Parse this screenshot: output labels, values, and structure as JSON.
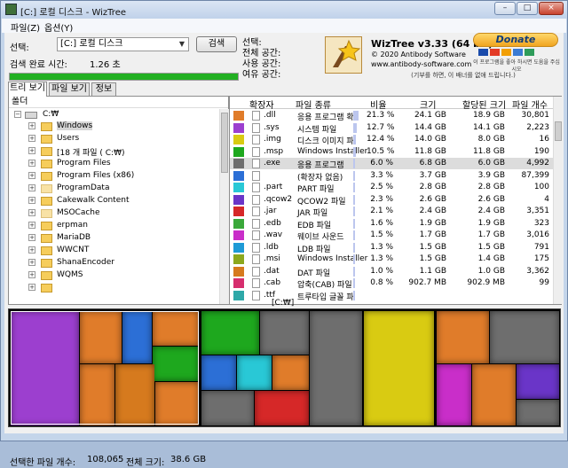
{
  "window": {
    "title": "[C:] 로컬 디스크 - WizTree",
    "controls": {
      "minimize": "–",
      "maximize": "□",
      "close": "×"
    }
  },
  "menu": [
    "파일(Z)",
    "옵션(Y)"
  ],
  "scan": {
    "select_label": "선택:",
    "drive_value": "[C:] 로컬 디스크",
    "search_button": "검색",
    "time_label": "검색 완료 시간:",
    "time_value": "1.26 초",
    "progress": 1.0,
    "progress_color": "#22b022"
  },
  "info": {
    "select_label": "선택:",
    "total_label": "전체 공간:",
    "used_label": "사용 공간:",
    "free_label": "여유 공간:"
  },
  "about": {
    "title": "WizTree v3.33 (64 bit)",
    "copyright": "© 2020 Antibody Software",
    "website": "www.antibody-software.com",
    "sponsor": "(기부를 하면, 이 배너를 없애 드립니다.)"
  },
  "donate": {
    "label": "Donate",
    "note": "이 프로그램을 좋아 하시면 도움을 주십시오",
    "card_colors": [
      "#1a4bab",
      "#e33b26",
      "#f29f05",
      "#3b7bd3",
      "#2e9c5a"
    ]
  },
  "tabs": [
    "트리 보기",
    "파일 보기",
    "정보"
  ],
  "tree": {
    "header": "폴더",
    "root": "C:₩",
    "items": [
      {
        "label": "Windows",
        "selected": true,
        "dim": false
      },
      {
        "label": "Users",
        "selected": false,
        "dim": false
      },
      {
        "label": "[18 개 파일 ( C:₩)",
        "selected": false,
        "dim": false
      },
      {
        "label": "Program Files",
        "selected": false,
        "dim": false
      },
      {
        "label": "Program Files (x86)",
        "selected": false,
        "dim": false
      },
      {
        "label": "ProgramData",
        "selected": false,
        "dim": true
      },
      {
        "label": "Cakewalk Content",
        "selected": false,
        "dim": false
      },
      {
        "label": "MSOCache",
        "selected": false,
        "dim": true
      },
      {
        "label": "erpman",
        "selected": false,
        "dim": false
      },
      {
        "label": "MariaDB",
        "selected": false,
        "dim": false
      },
      {
        "label": "WWCNT",
        "selected": false,
        "dim": false
      },
      {
        "label": "ShanaEncoder",
        "selected": false,
        "dim": false
      },
      {
        "label": "WQMS",
        "selected": false,
        "dim": false
      },
      {
        "label": "",
        "selected": false,
        "dim": false
      }
    ]
  },
  "grid": {
    "headers": {
      "ext": "확장자",
      "type": "파일 종류",
      "percent": "비율",
      "size": "크기",
      "allocated": "할당된 크기",
      "count": "파일 개수"
    },
    "rows": [
      {
        "ext": ".dll",
        "type": "응용 프로그램 확",
        "percent": "21.3 %",
        "pct": 21.3,
        "size": "24.1 GB",
        "alloc": "18.9 GB",
        "count": "30,801",
        "color": "#e07c2a",
        "selected": false
      },
      {
        "ext": ".sys",
        "type": "시스템 파일",
        "percent": "12.7 %",
        "pct": 12.7,
        "size": "14.4 GB",
        "alloc": "14.1 GB",
        "count": "2,223",
        "color": "#9c3fcf",
        "selected": false
      },
      {
        "ext": ".img",
        "type": "디스크 이미지 파",
        "percent": "12.4 %",
        "pct": 12.4,
        "size": "14.0 GB",
        "alloc": "8.0 GB",
        "count": "16",
        "color": "#d9cb12",
        "selected": false
      },
      {
        "ext": ".msp",
        "type": "Windows Installer",
        "percent": "10.5 %",
        "pct": 10.5,
        "size": "11.8 GB",
        "alloc": "11.8 GB",
        "count": "190",
        "color": "#1ea81e",
        "selected": false
      },
      {
        "ext": ".exe",
        "type": "응용 프로그램",
        "percent": "6.0 %",
        "pct": 6.0,
        "size": "6.8 GB",
        "alloc": "6.0 GB",
        "count": "4,992",
        "color": "#6e6e6e",
        "selected": true
      },
      {
        "ext": "",
        "type": "(확장자 없음)",
        "percent": "3.3 %",
        "pct": 3.3,
        "size": "3.7 GB",
        "alloc": "3.9 GB",
        "count": "87,399",
        "color": "#2c6fd6",
        "selected": false
      },
      {
        "ext": ".part",
        "type": "PART 파일",
        "percent": "2.5 %",
        "pct": 2.5,
        "size": "2.8 GB",
        "alloc": "2.8 GB",
        "count": "100",
        "color": "#29c8d6",
        "selected": false
      },
      {
        "ext": ".qcow2",
        "type": "QCOW2 파일",
        "percent": "2.3 %",
        "pct": 2.3,
        "size": "2.6 GB",
        "alloc": "2.6 GB",
        "count": "4",
        "color": "#6a35c8",
        "selected": false
      },
      {
        "ext": ".jar",
        "type": "JAR 파일",
        "percent": "2.1 %",
        "pct": 2.1,
        "size": "2.4 GB",
        "alloc": "2.4 GB",
        "count": "3,351",
        "color": "#d62828",
        "selected": false
      },
      {
        "ext": ".edb",
        "type": "EDB 파일",
        "percent": "1.6 %",
        "pct": 1.6,
        "size": "1.9 GB",
        "alloc": "1.9 GB",
        "count": "323",
        "color": "#3aa83a",
        "selected": false
      },
      {
        "ext": ".wav",
        "type": "웨이브 사운드",
        "percent": "1.5 %",
        "pct": 1.5,
        "size": "1.7 GB",
        "alloc": "1.7 GB",
        "count": "3,016",
        "color": "#c92ec9",
        "selected": false
      },
      {
        "ext": ".ldb",
        "type": "LDB 파일",
        "percent": "1.3 %",
        "pct": 1.3,
        "size": "1.5 GB",
        "alloc": "1.5 GB",
        "count": "791",
        "color": "#1e9ad6",
        "selected": false
      },
      {
        "ext": ".msi",
        "type": "Windows Installer",
        "percent": "1.3 %",
        "pct": 1.3,
        "size": "1.5 GB",
        "alloc": "1.4 GB",
        "count": "175",
        "color": "#8ca81e",
        "selected": false
      },
      {
        "ext": ".dat",
        "type": "DAT 파일",
        "percent": "1.0 %",
        "pct": 1.0,
        "size": "1.1 GB",
        "alloc": "1.0 GB",
        "count": "3,362",
        "color": "#d67a1e",
        "selected": false
      },
      {
        "ext": ".cab",
        "type": "압축(CAB) 파일",
        "percent": "0.8 %",
        "pct": 0.8,
        "size": "902.7 MB",
        "alloc": "902.9 MB",
        "count": "99",
        "color": "#d62e6e",
        "selected": false
      },
      {
        "ext": ".ttf",
        "type": "트루타입 글꼴 파",
        "percent": "",
        "pct": 0.7,
        "size": "",
        "alloc": "",
        "count": "",
        "color": "#2ea8a8",
        "selected": false
      }
    ]
  },
  "treemap": {
    "path": "[C:₩]"
  },
  "status": {
    "files_label": "선택한 파일 개수:",
    "files_value": "108,065",
    "size_label": "전체 크기:",
    "size_value": "38.6 GB"
  }
}
